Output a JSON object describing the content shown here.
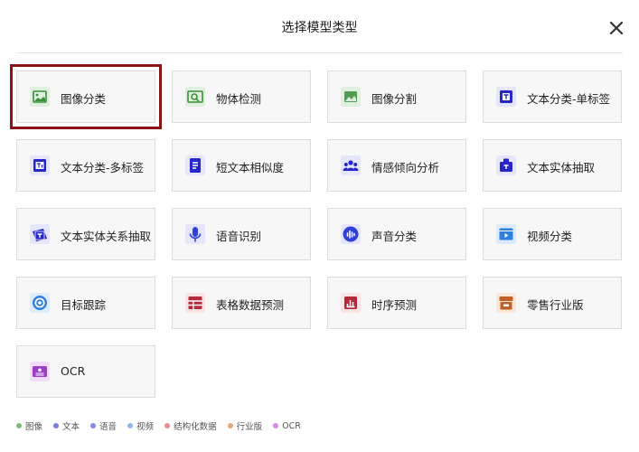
{
  "dialog": {
    "title": "选择模型类型"
  },
  "cards": [
    {
      "label": "图像分类",
      "icon": "image-icon",
      "category": "image"
    },
    {
      "label": "物体检测",
      "icon": "object-detection-icon",
      "category": "image"
    },
    {
      "label": "图像分割",
      "icon": "image-segmentation-icon",
      "category": "image"
    },
    {
      "label": "文本分类-单标签",
      "icon": "text-single-label-icon",
      "category": "text"
    },
    {
      "label": "文本分类-多标签",
      "icon": "text-multi-label-icon",
      "category": "text"
    },
    {
      "label": "短文本相似度",
      "icon": "document-icon",
      "category": "text"
    },
    {
      "label": "情感倾向分析",
      "icon": "people-icon",
      "category": "text"
    },
    {
      "label": "文本实体抽取",
      "icon": "entity-extraction-icon",
      "category": "text"
    },
    {
      "label": "文本实体关系抽取",
      "icon": "relation-extraction-icon",
      "category": "text"
    },
    {
      "label": "语音识别",
      "icon": "microphone-icon",
      "category": "speech"
    },
    {
      "label": "声音分类",
      "icon": "sound-wave-icon",
      "category": "speech"
    },
    {
      "label": "视频分类",
      "icon": "video-icon",
      "category": "video"
    },
    {
      "label": "目标跟踪",
      "icon": "target-icon",
      "category": "video"
    },
    {
      "label": "表格数据预测",
      "icon": "table-icon",
      "category": "structured"
    },
    {
      "label": "时序预测",
      "icon": "bar-chart-icon",
      "category": "structured"
    },
    {
      "label": "零售行业版",
      "icon": "store-icon",
      "category": "industry"
    },
    {
      "label": "OCR",
      "icon": "id-card-icon",
      "category": "ocr"
    }
  ],
  "legend": [
    {
      "label": "图像",
      "color": "#7dba7d"
    },
    {
      "label": "文本",
      "color": "#7c7ce0"
    },
    {
      "label": "语音",
      "color": "#8a8ae8"
    },
    {
      "label": "视频",
      "color": "#8fb6ee"
    },
    {
      "label": "结构化数据",
      "color": "#e58d8d"
    },
    {
      "label": "行业版",
      "color": "#e8a777"
    },
    {
      "label": "OCR",
      "color": "#d18ce8"
    }
  ],
  "colors": {
    "image_bg": "#dff0df",
    "image_fg": "#3c8d3c",
    "text_bg": "#e5e5fb",
    "text_fg": "#2727c9",
    "speech_bg": "#e5e5fb",
    "speech_fg": "#2f3fd8",
    "video_bg": "#dcecfb",
    "video_fg": "#2f7fe0",
    "structured_bg": "#fbe3e3",
    "structured_fg": "#b32a3a",
    "industry_bg": "#fbe7d6",
    "industry_fg": "#c0602a",
    "ocr_bg": "#f1ddfb",
    "ocr_fg": "#9b3fc7",
    "highlight": "#8b1414"
  }
}
